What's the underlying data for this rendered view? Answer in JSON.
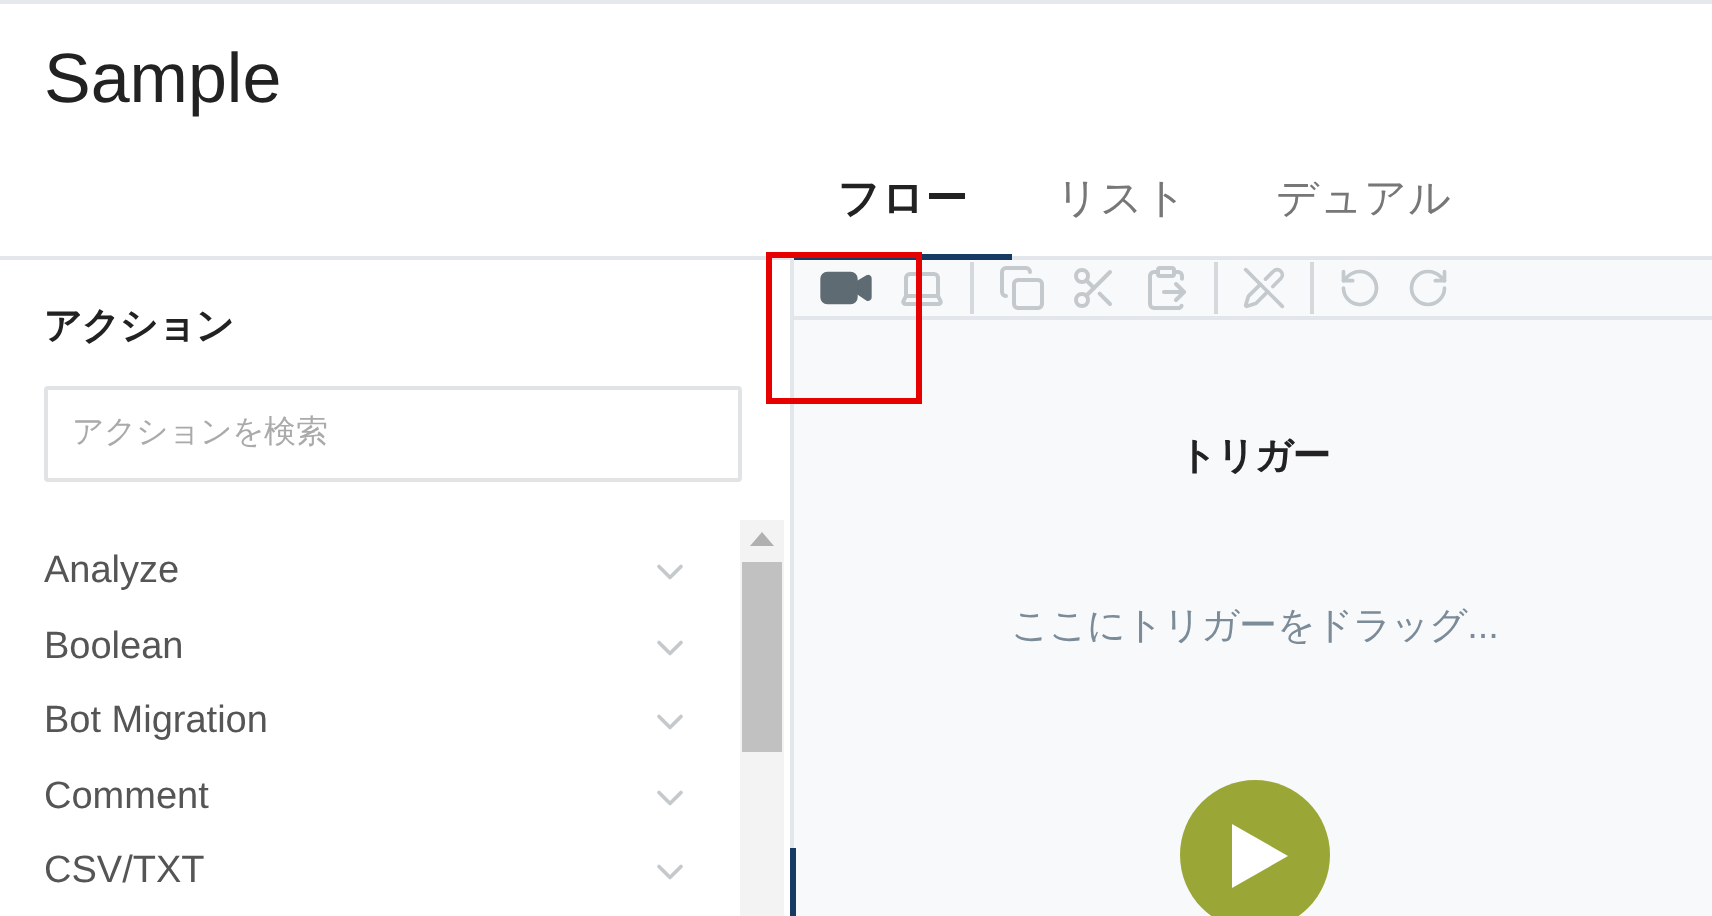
{
  "page": {
    "title": "Sample"
  },
  "tabs": [
    {
      "label": "フロー",
      "selected": true
    },
    {
      "label": "リスト",
      "selected": false
    },
    {
      "label": "デュアル",
      "selected": false
    }
  ],
  "actions_panel": {
    "heading": "アクション",
    "search": {
      "placeholder": "アクションを検索"
    },
    "items": [
      {
        "label": "Analyze",
        "expanded": false
      },
      {
        "label": "Boolean",
        "expanded": false
      },
      {
        "label": "Bot Migration",
        "expanded": false
      },
      {
        "label": "Comment",
        "expanded": false
      },
      {
        "label": "CSV/TXT",
        "expanded": false
      }
    ]
  },
  "canvas": {
    "trigger_heading": "トリガー",
    "trigger_hint": "ここにトリガーをドラッグ..."
  }
}
